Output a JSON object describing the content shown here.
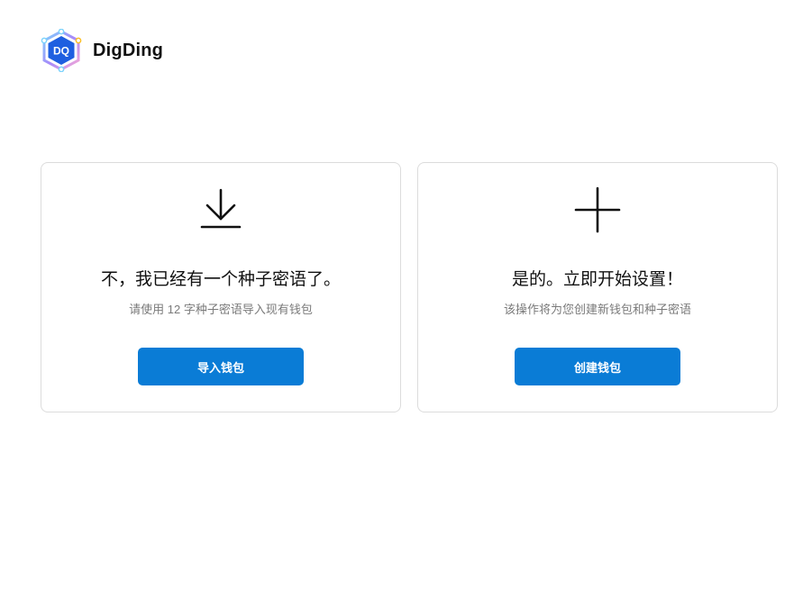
{
  "header": {
    "brand_name": "DigDing",
    "logo_text": "DQ"
  },
  "cards": [
    {
      "icon": "download-icon",
      "title": "不，我已经有一个种子密语了。",
      "description": "请使用 12 字种子密语导入现有钱包",
      "button_label": "导入钱包"
    },
    {
      "icon": "plus-icon",
      "title": "是的。立即开始设置！",
      "description": "该操作将为您创建新钱包和种子密语",
      "button_label": "创建钱包"
    }
  ],
  "colors": {
    "primary_button": "#0a7cd6",
    "card_border": "#dcdcdc",
    "logo_blue": "#1f5fe0"
  }
}
